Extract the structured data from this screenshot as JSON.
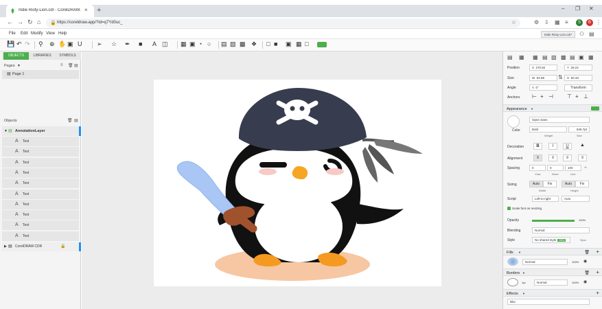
{
  "browser": {
    "tab_title": "Indie Rioty-Lion.cdr - CorelDRAW.",
    "tab_close": "×",
    "new_tab": "+",
    "url": "https://coreldraw.app/?id=q7Yd0uc_",
    "profile_letter": "S",
    "profile_color": "#2e7d32",
    "notify_letter": "B",
    "notify_color": "#d32f2f"
  },
  "menu": [
    "File",
    "Edit",
    "Modify",
    "View",
    "Help"
  ],
  "doc_chip": "Indie Rioty-Lion.cdr*",
  "left_panel": {
    "tabs": [
      "OBJECTS",
      "LIBRARIES",
      "SYMBOLS"
    ],
    "pages_header": "Pages",
    "page_item": "Page 1",
    "objects_header": "Objects",
    "layer_name": "AnnotationLayer",
    "text_items": [
      "Text",
      "Text",
      "Text",
      "Text",
      "Text",
      "Text",
      "Text",
      "Text",
      "Text",
      "Text"
    ],
    "master_layer": "CorelDRAW CDR"
  },
  "right_panel": {
    "position_label": "Position",
    "pos_x_prefix": "X",
    "pos_x": "270.82",
    "pos_y_prefix": "Y",
    "pos_y": "29.24",
    "size_label": "Size",
    "size_w_prefix": "W",
    "size_w": "94.88",
    "size_h_prefix": "H",
    "size_h": "60.33",
    "angle_label": "Angle",
    "angle_prefix": "A",
    "angle_value": "0°",
    "transform_button": "Transform",
    "anchors_label": "Anchors",
    "appearance_header": "Appearance",
    "font_name": "Open Sans",
    "color_label": "Color",
    "weight_value": "Bold",
    "size_value": "846.7pt",
    "weight_label": "Weight",
    "size_caption": "Size",
    "decoration_label": "Decoration",
    "alignment_label": "Alignment",
    "spacing_label": "Spacing",
    "spacing_values": [
      "0",
      "0",
      "100",
      "%"
    ],
    "spacing_captions": [
      "Char",
      "Word",
      "Line"
    ],
    "sizing_label": "Sizing",
    "sizing_options": [
      "Auto",
      "Fix",
      "Auto",
      "Fix"
    ],
    "sizing_captions": [
      "Width",
      "Height"
    ],
    "script_label": "Script",
    "script_value": "Left-to-right",
    "script_auto": "Auto",
    "scale_checkbox": "Scale font on resizing",
    "opacity_label": "Opacity",
    "opacity_percent": 100,
    "opacity_text": "100%",
    "blending_label": "Blending",
    "blending_value": "Normal",
    "style_label": "Style",
    "style_value": "No shared style",
    "style_badge": "NEW",
    "sync_label": "Sync",
    "fills_header": "Fills",
    "fill_mode": "Normal",
    "fill_opacity": "100%",
    "borders_header": "Borders",
    "border_width": "1pt",
    "border_mode": "Normal",
    "border_opacity": "100%",
    "effects_header": "Effects",
    "effect_value": "Blur"
  },
  "colors": {
    "accent": "#4cae4c",
    "selection_blue": "#1f8ff0",
    "penguin_black": "#111111",
    "hat": "#373d4e",
    "beak": "#f5a623",
    "feet": "#f59a20",
    "ground": "#f6c7a2",
    "sword": "#a9c6f5",
    "handle": "#a0522d"
  }
}
